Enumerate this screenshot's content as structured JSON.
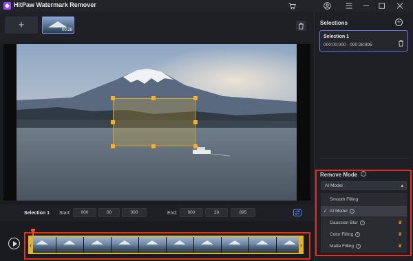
{
  "app": {
    "title": "HitPaw Watermark Remover"
  },
  "titlebar_icons": [
    "cart-icon",
    "user-icon",
    "menu-icon",
    "minimize-icon",
    "maximize-icon",
    "close-icon"
  ],
  "toolbar": {
    "add_label": "+",
    "thumbnail_time": "00:28"
  },
  "time_controls": {
    "selection_label": "Selection 1",
    "start_label": "Start:",
    "start_h": "000",
    "start_m": "00",
    "start_ms": "000",
    "end_label": "End:",
    "end_h": "000",
    "end_m": "28",
    "end_ms": "895"
  },
  "selections_panel": {
    "title": "Selections",
    "items": [
      {
        "name": "Selection 1",
        "range": "000:00:000 - 000:28:895"
      }
    ]
  },
  "remove_mode": {
    "title": "Remove Mode",
    "selected": "AI Model",
    "options": [
      {
        "label": "Smooth Filling",
        "info": false,
        "premium": false,
        "selected": false
      },
      {
        "label": "AI Model",
        "info": true,
        "premium": false,
        "selected": true
      },
      {
        "label": "Gaussion Blur",
        "info": true,
        "premium": true,
        "selected": false
      },
      {
        "label": "Color Filling",
        "info": true,
        "premium": true,
        "selected": false
      },
      {
        "label": "Matte Filling",
        "info": true,
        "premium": true,
        "selected": false
      }
    ]
  },
  "timeline": {
    "frame_count": 10
  },
  "colors": {
    "accent": "#6777e8",
    "highlight_red": "#e0321e",
    "selection_yellow": "#e8b424"
  }
}
